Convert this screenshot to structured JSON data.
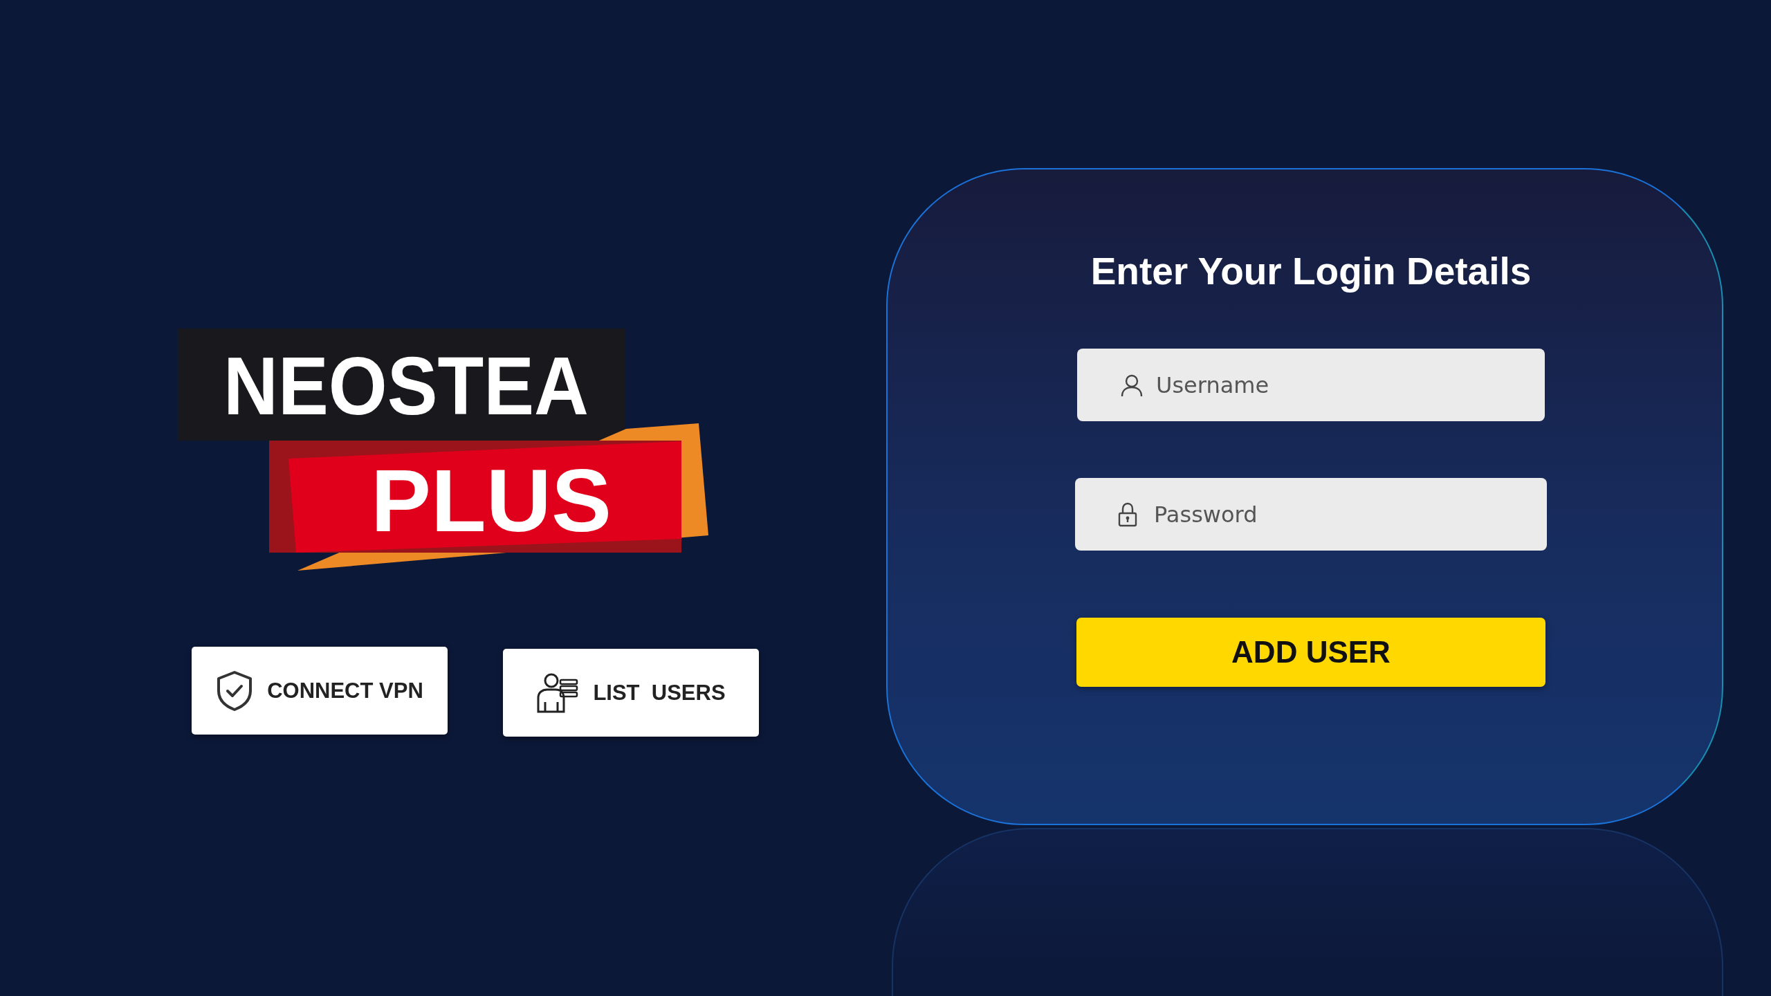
{
  "logo": {
    "line_1": "NEOSTEA",
    "line_2": "PLUS"
  },
  "actions": [
    {
      "kind": "shield",
      "label": "CONNECT VPN"
    },
    {
      "kind": "users",
      "label": "LIST  USERS"
    }
  ],
  "login": {
    "title": "Enter Your Login Details",
    "fields": [
      {
        "kind": "user",
        "placeholder": "Username"
      },
      {
        "kind": "lock",
        "placeholder": "Password"
      }
    ],
    "submit": "ADD USER"
  }
}
